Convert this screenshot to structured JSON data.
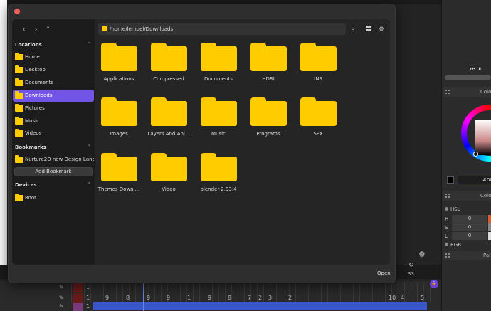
{
  "dialog": {
    "nav": {
      "back": "‹",
      "forward": "›",
      "up": "˄"
    },
    "path": "/home/lemuel/Downloads",
    "open_label": "Open",
    "sidebar": {
      "locations_header": "Locations",
      "locations": [
        "Home",
        "Desktop",
        "Documents",
        "Downloads",
        "Pictures",
        "Music",
        "Videos"
      ],
      "active_location": "Downloads",
      "bookmarks_header": "Bookmarks",
      "bookmarks": [
        "Nurture2D new Design Langu..."
      ],
      "add_bookmark_label": "Add Bookmark",
      "devices_header": "Devices",
      "devices": [
        "Root"
      ]
    },
    "files": [
      "Applications",
      "Compressed",
      "Documents",
      "HDRI",
      "INS",
      "Images",
      "Layers And Ani...",
      "Music",
      "Programs",
      "SFX",
      "Themes Downl...",
      "Video",
      "blender-2.93.4"
    ]
  },
  "background": {
    "color_panel_title": "Colo",
    "color_panel2_title": "Colo",
    "palette_title": "Pal",
    "hex_value": "#00",
    "hsl_label": "HSL",
    "rgb_label": "RGB",
    "hsl": [
      {
        "label": "H",
        "value": "0",
        "color": "#e05a2a"
      },
      {
        "label": "S",
        "value": "0",
        "color": "#888888"
      },
      {
        "label": "L",
        "value": "0",
        "color": "#dddddd"
      }
    ],
    "frame_count": "33",
    "timeline_row1": [
      "1"
    ],
    "timeline_row2": [
      "1",
      "9",
      "8",
      "9",
      "9",
      "1",
      "9",
      "8",
      "7",
      "2",
      "3",
      "2",
      "10",
      "4",
      "5"
    ],
    "timeline_row3": [
      "1"
    ]
  },
  "colors": {
    "accent": "#7355e6",
    "folder": "#ffcc00",
    "close": "#ec5f5a"
  }
}
